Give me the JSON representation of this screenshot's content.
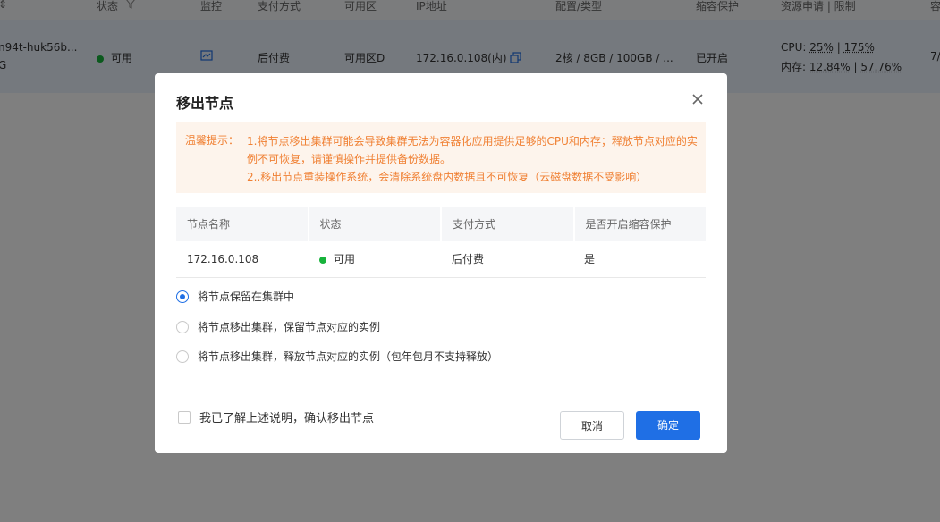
{
  "background": {
    "headers": [
      {
        "label": "状态"
      },
      {
        "label": "监控"
      },
      {
        "label": "支付方式"
      },
      {
        "label": "可用区"
      },
      {
        "label": "IP地址"
      },
      {
        "label": "配置/类型"
      },
      {
        "label": "缩容保护"
      },
      {
        "label": "资源申请 | 限制"
      },
      {
        "label": "容"
      }
    ],
    "row": {
      "name": "n94t-huk56b...",
      "name_sub": "G",
      "status": "可用",
      "payment": "后付费",
      "zone": "可用区D",
      "ip": "172.16.0.108(内)",
      "config": "2核 / 8GB / 100GB / ...",
      "protection": "已开启",
      "cpu_label": "CPU:",
      "cpu_request": "25%",
      "cpu_limit": "175%",
      "mem_label": "内存:",
      "mem_request": "12.84%",
      "mem_limit": "57.76%",
      "separator": "|",
      "extra": "7/"
    }
  },
  "dialog": {
    "title": "移出节点",
    "warning": {
      "label": "温馨提示：",
      "line1": "1.将节点移出集群可能会导致集群无法为容器化应用提供足够的CPU和内存；释放节点对应的实例不可恢复，请谨慎操作并提供备份数据。",
      "line2": "2..移出节点重装操作系统，会清除系统盘内数据且不可恢复（云磁盘数据不受影响）"
    },
    "table": {
      "headers": [
        "节点名称",
        "状态",
        "支付方式",
        "是否开启缩容保护"
      ],
      "row": {
        "name": "172.16.0.108",
        "status": "可用",
        "payment": "后付费",
        "protection": "是"
      }
    },
    "options": [
      {
        "label": "将节点保留在集群中",
        "checked": true
      },
      {
        "label": "将节点移出集群，保留节点对应的实例",
        "checked": false
      },
      {
        "label": "将节点移出集群，释放节点对应的实例（包年包月不支持释放）",
        "checked": false
      }
    ],
    "confirm_label": "我已了解上述说明，确认移出节点",
    "cancel_label": "取消",
    "ok_label": "确定"
  },
  "colors": {
    "accent": "#1f6fe5",
    "warning_text": "#f08033",
    "warning_bg": "#fdf4ec",
    "status_green": "#17b33b"
  }
}
